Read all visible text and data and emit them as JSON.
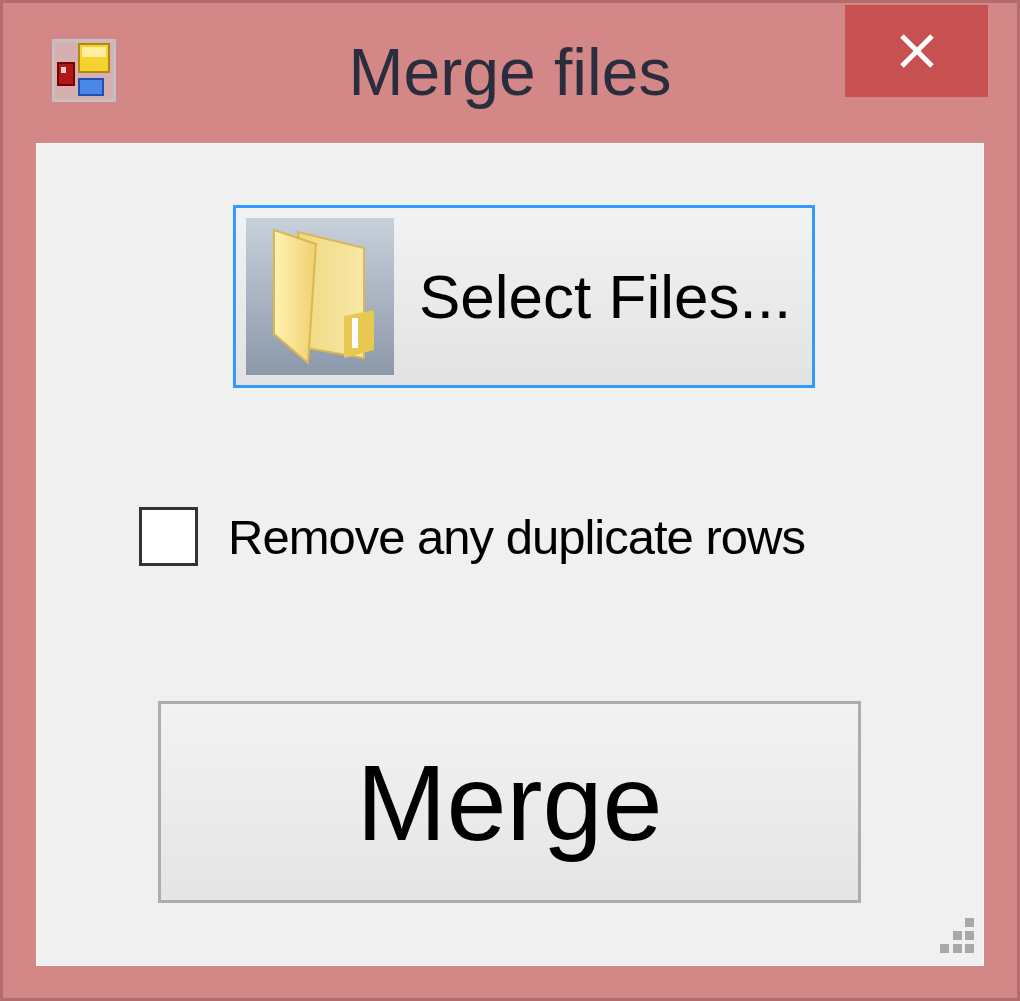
{
  "window": {
    "title": "Merge files"
  },
  "select_button": {
    "label": "Select Files...",
    "focused": true
  },
  "checkbox": {
    "label": "Remove any duplicate rows",
    "checked": false
  },
  "merge_button": {
    "label": "Merge"
  }
}
